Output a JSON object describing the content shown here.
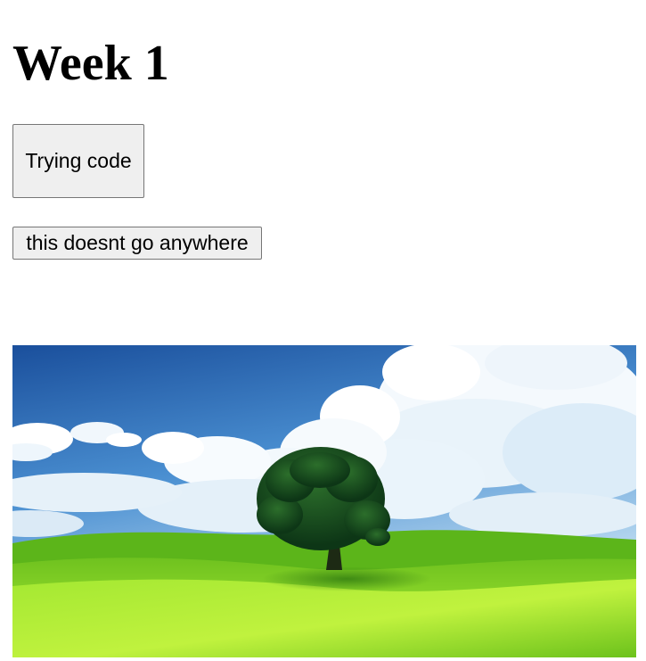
{
  "heading": {
    "title": "Week 1"
  },
  "buttons": {
    "trying_code_label": "Trying code",
    "nowhere_label": "this doesnt go anywhere"
  },
  "image": {
    "subject": "landscape-tree-on-green-hill-under-blue-sky",
    "colors": {
      "sky_top": "#1f5fae",
      "sky_bottom": "#c6e2f5",
      "grass_light": "#b6ee3a",
      "grass_dark": "#4fa716",
      "tree": "#14491f"
    }
  }
}
